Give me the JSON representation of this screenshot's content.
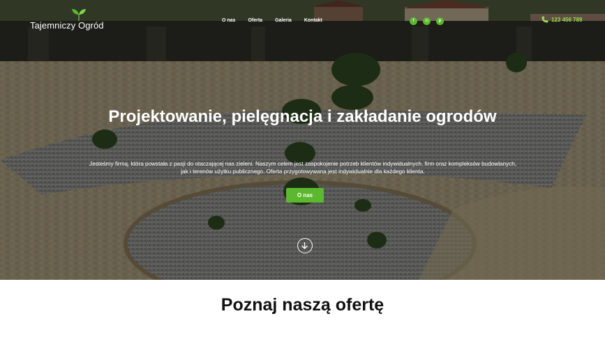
{
  "brand": {
    "logo_text": "Tajemniczy Ogród"
  },
  "nav": {
    "items": [
      {
        "label": "O nas"
      },
      {
        "label": "Oferta"
      },
      {
        "label": "Galeria"
      },
      {
        "label": "Kontakt"
      }
    ]
  },
  "social": {
    "icons": [
      "facebook-icon",
      "instagram-icon",
      "pinterest-icon"
    ],
    "glyphs": [
      "f",
      "◎",
      "p"
    ]
  },
  "contact": {
    "phone": "123 456 789"
  },
  "hero": {
    "title": "Projektowanie, pielęgnacja i zakładanie ogrodów",
    "description": "Jesteśmy firmą, która powstała z pasji do otaczającej nas zieleni. Naszym celem jest zaspokojenie potrzeb klientów indywidualnych, firm oraz kompleksów budowlanych, jak i terenów użytku publicznego. Oferta przygotowywana jest indywidualnie dla każdego klienta.",
    "cta_label": "O nas"
  },
  "offer_section": {
    "title": "Poznaj naszą ofertę"
  },
  "colors": {
    "accent": "#5cb82e",
    "phone": "#8fe04a",
    "heading": "#111111"
  }
}
